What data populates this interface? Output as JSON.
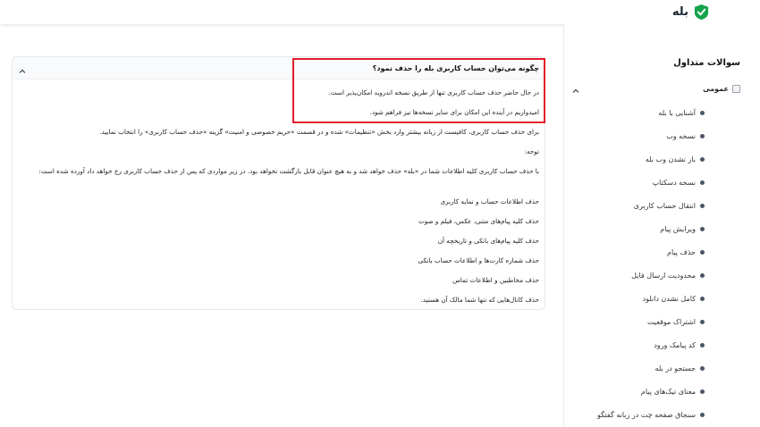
{
  "header": {
    "brand": "بله",
    "brand_color": "#16a34a"
  },
  "sidebar": {
    "title": "سوالات متداول",
    "category": {
      "label": "عمومی",
      "icon": "broken-image-icon",
      "expanded": true
    },
    "items": [
      {
        "label": "آشنایی با بله"
      },
      {
        "label": "نسخه وب"
      },
      {
        "label": "باز نشدن وب بله"
      },
      {
        "label": "نسخه دسکتاپ"
      },
      {
        "label": "انتقال حساب کاربری"
      },
      {
        "label": "ویرایش پیام"
      },
      {
        "label": "حذف پیام"
      },
      {
        "label": "محدودیت ارسال فایل"
      },
      {
        "label": "کامل نشدن دانلود"
      },
      {
        "label": "اشتراک موقعیت"
      },
      {
        "label": "کد پیامک ورود"
      },
      {
        "label": "جستجو در بله"
      },
      {
        "label": "معنای تیک‌های پیام"
      },
      {
        "label": "سنجاق صفحه چت در زبانه گفتگو"
      }
    ]
  },
  "faq": {
    "question": "چگونه می‌توان حساب کاربری بله را حذف نمود؟",
    "answer": [
      "در حال حاضر حذف حساب کاربری تنها از طریق نسخه اندروید امکان‌پذیر است.",
      "امیدواریم در آینده این امکان برای سایر نسخه‌ها نیز فراهم شود.",
      "برای حذف حساب کاربری، کافیست از زبانه بیشتر وارد بخش «تنظیمات» شده و در قسمت «حریم خصوصی و امنیت» گزینه «حذف حساب کاربری» را انتخاب نمایید.",
      "توجه:",
      "با حذف حساب کاربری کلیه اطلاعات شما در «بله» حذف خواهد شد و به هیچ عنوان قابل بازگشت نخواهد بود. در زیر مواردی که پس از حذف حساب کاربری رخ خواهد داد آورده شده است:",
      "حذف اطلاعات حساب و نمایه کاربری",
      "حذف کلیه پیام‌های متنی، عکس، فیلم و صوت",
      "حذف کلیه پیام‌های بانکی و تاریخچه آن",
      "حذف شماره کارت‌ها و اطلاعات حساب بانکی",
      "حذف مخاطبین و اطلاعات تماس",
      "حذف کانال‌هایی که تنها شما مالک آن هستید."
    ]
  },
  "highlight_color": "#e11d2a"
}
